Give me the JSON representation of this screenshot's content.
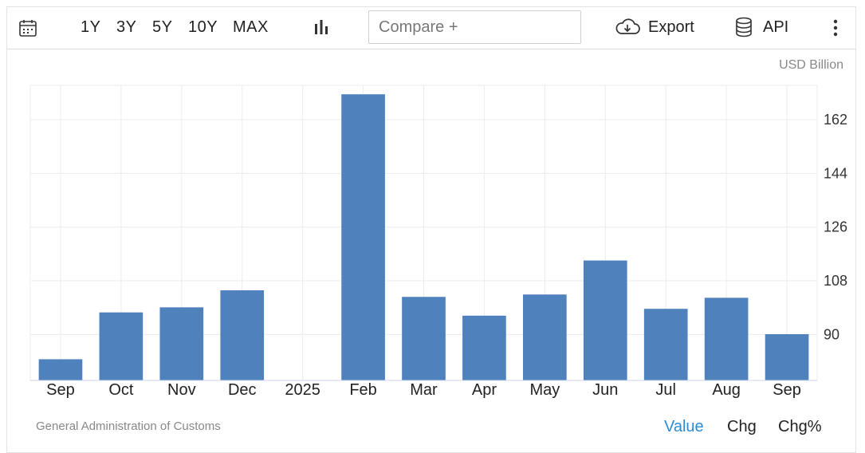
{
  "toolbar": {
    "calendar_icon": "calendar-icon",
    "ranges": [
      "1Y",
      "3Y",
      "5Y",
      "10Y",
      "MAX"
    ],
    "chart_type_icon": "bar-chart-icon",
    "compare_placeholder": "Compare +",
    "export_label": "Export",
    "export_icon": "cloud-download-icon",
    "api_label": "API",
    "api_icon": "database-icon",
    "more_icon": "more-vertical-icon"
  },
  "unit_label": "USD Billion",
  "source": "General Administration of Customs",
  "footer_tabs": [
    "Value",
    "Chg",
    "Chg%"
  ],
  "active_tab": "Value",
  "colors": {
    "bar": "#4f81bd",
    "active_tab": "#2b8cd6",
    "grid": "#ececec"
  },
  "chart_data": {
    "type": "bar",
    "categories": [
      "Sep",
      "Oct",
      "Nov",
      "Dec",
      "2025",
      "Feb",
      "Mar",
      "Apr",
      "May",
      "Jun",
      "Jul",
      "Aug",
      "Sep"
    ],
    "values": [
      81.7,
      97.4,
      99.1,
      104.8,
      null,
      170.5,
      102.6,
      96.3,
      103.4,
      114.8,
      98.6,
      102.3,
      90.1
    ],
    "ylim": [
      74.6,
      173.5
    ],
    "yticks": [
      90,
      108,
      126,
      144,
      162
    ],
    "y_axis_position": "right",
    "grid": true
  }
}
